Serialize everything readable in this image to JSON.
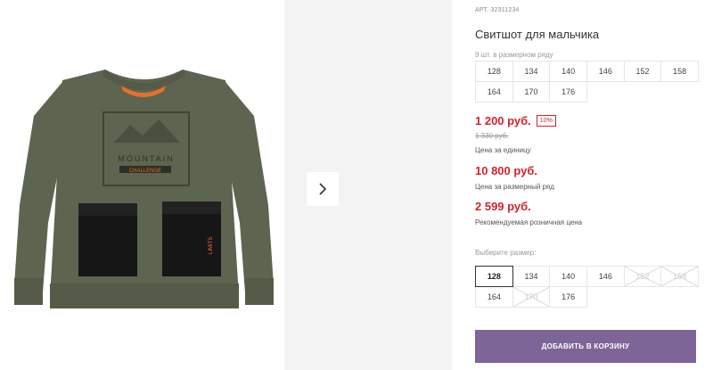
{
  "product": {
    "sku": "АРТ. 32311234",
    "title": "Свитшот для мальчика",
    "series_note": "9 шт. в размерном ряду"
  },
  "series_sizes": [
    "128",
    "134",
    "140",
    "146",
    "152",
    "158",
    "164",
    "170",
    "176"
  ],
  "pricing": {
    "unit_price": "1 200 руб.",
    "discount": "10%",
    "old_price": "1 330 руб.",
    "unit_caption": "Цена за единицу",
    "series_price": "10 800 руб.",
    "series_caption": "Цена за размерный ряд",
    "retail_price": "2 599 руб.",
    "retail_caption": "Рекомендуемая розничная цена"
  },
  "size_choice": {
    "label": "Выберите размер:",
    "options": [
      {
        "size": "128",
        "state": "selected"
      },
      {
        "size": "134",
        "state": "available"
      },
      {
        "size": "140",
        "state": "available"
      },
      {
        "size": "146",
        "state": "available"
      },
      {
        "size": "152",
        "state": "unavailable"
      },
      {
        "size": "158",
        "state": "unavailable"
      },
      {
        "size": "164",
        "state": "available"
      },
      {
        "size": "170",
        "state": "unavailable"
      },
      {
        "size": "176",
        "state": "available"
      }
    ]
  },
  "gallery": {
    "print_line1": "MOUNTAIN",
    "print_line2": "CHALLENGE",
    "pocket_tag": "LIMITS"
  },
  "cart": {
    "button_label": "ДОБАВИТЬ В КОРЗИНУ"
  },
  "colors": {
    "price_red": "#d0242e",
    "cart_purple": "#7d6598",
    "garment_olive": "#5d6450"
  },
  "icons": [
    "chevron-right-icon"
  ]
}
